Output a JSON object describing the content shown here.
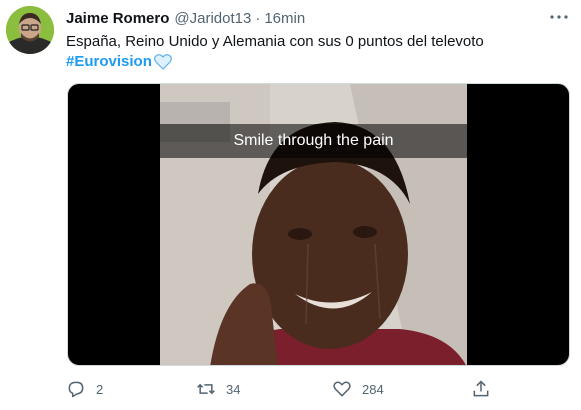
{
  "author": {
    "name": "Jaime Romero",
    "handle": "@Jaridot13",
    "separator": "·",
    "time": "16min"
  },
  "tweet": {
    "text": "España, Reino Unido y Alemania con sus 0 puntos del televoto",
    "hashtag": "#Eurovision"
  },
  "media": {
    "caption": "Smile through the pain"
  },
  "actions": {
    "reply_count": "2",
    "retweet_count": "34",
    "like_count": "284"
  },
  "icons": {
    "more": "more-icon",
    "reply": "reply-icon",
    "retweet": "retweet-icon",
    "like": "like-icon",
    "share": "share-icon",
    "hashtag_emoji": "blue-heart-icon"
  },
  "colors": {
    "accent": "#1d9bf0",
    "secondary_text": "#536471",
    "avatar_bg": "#8bbd3f"
  }
}
